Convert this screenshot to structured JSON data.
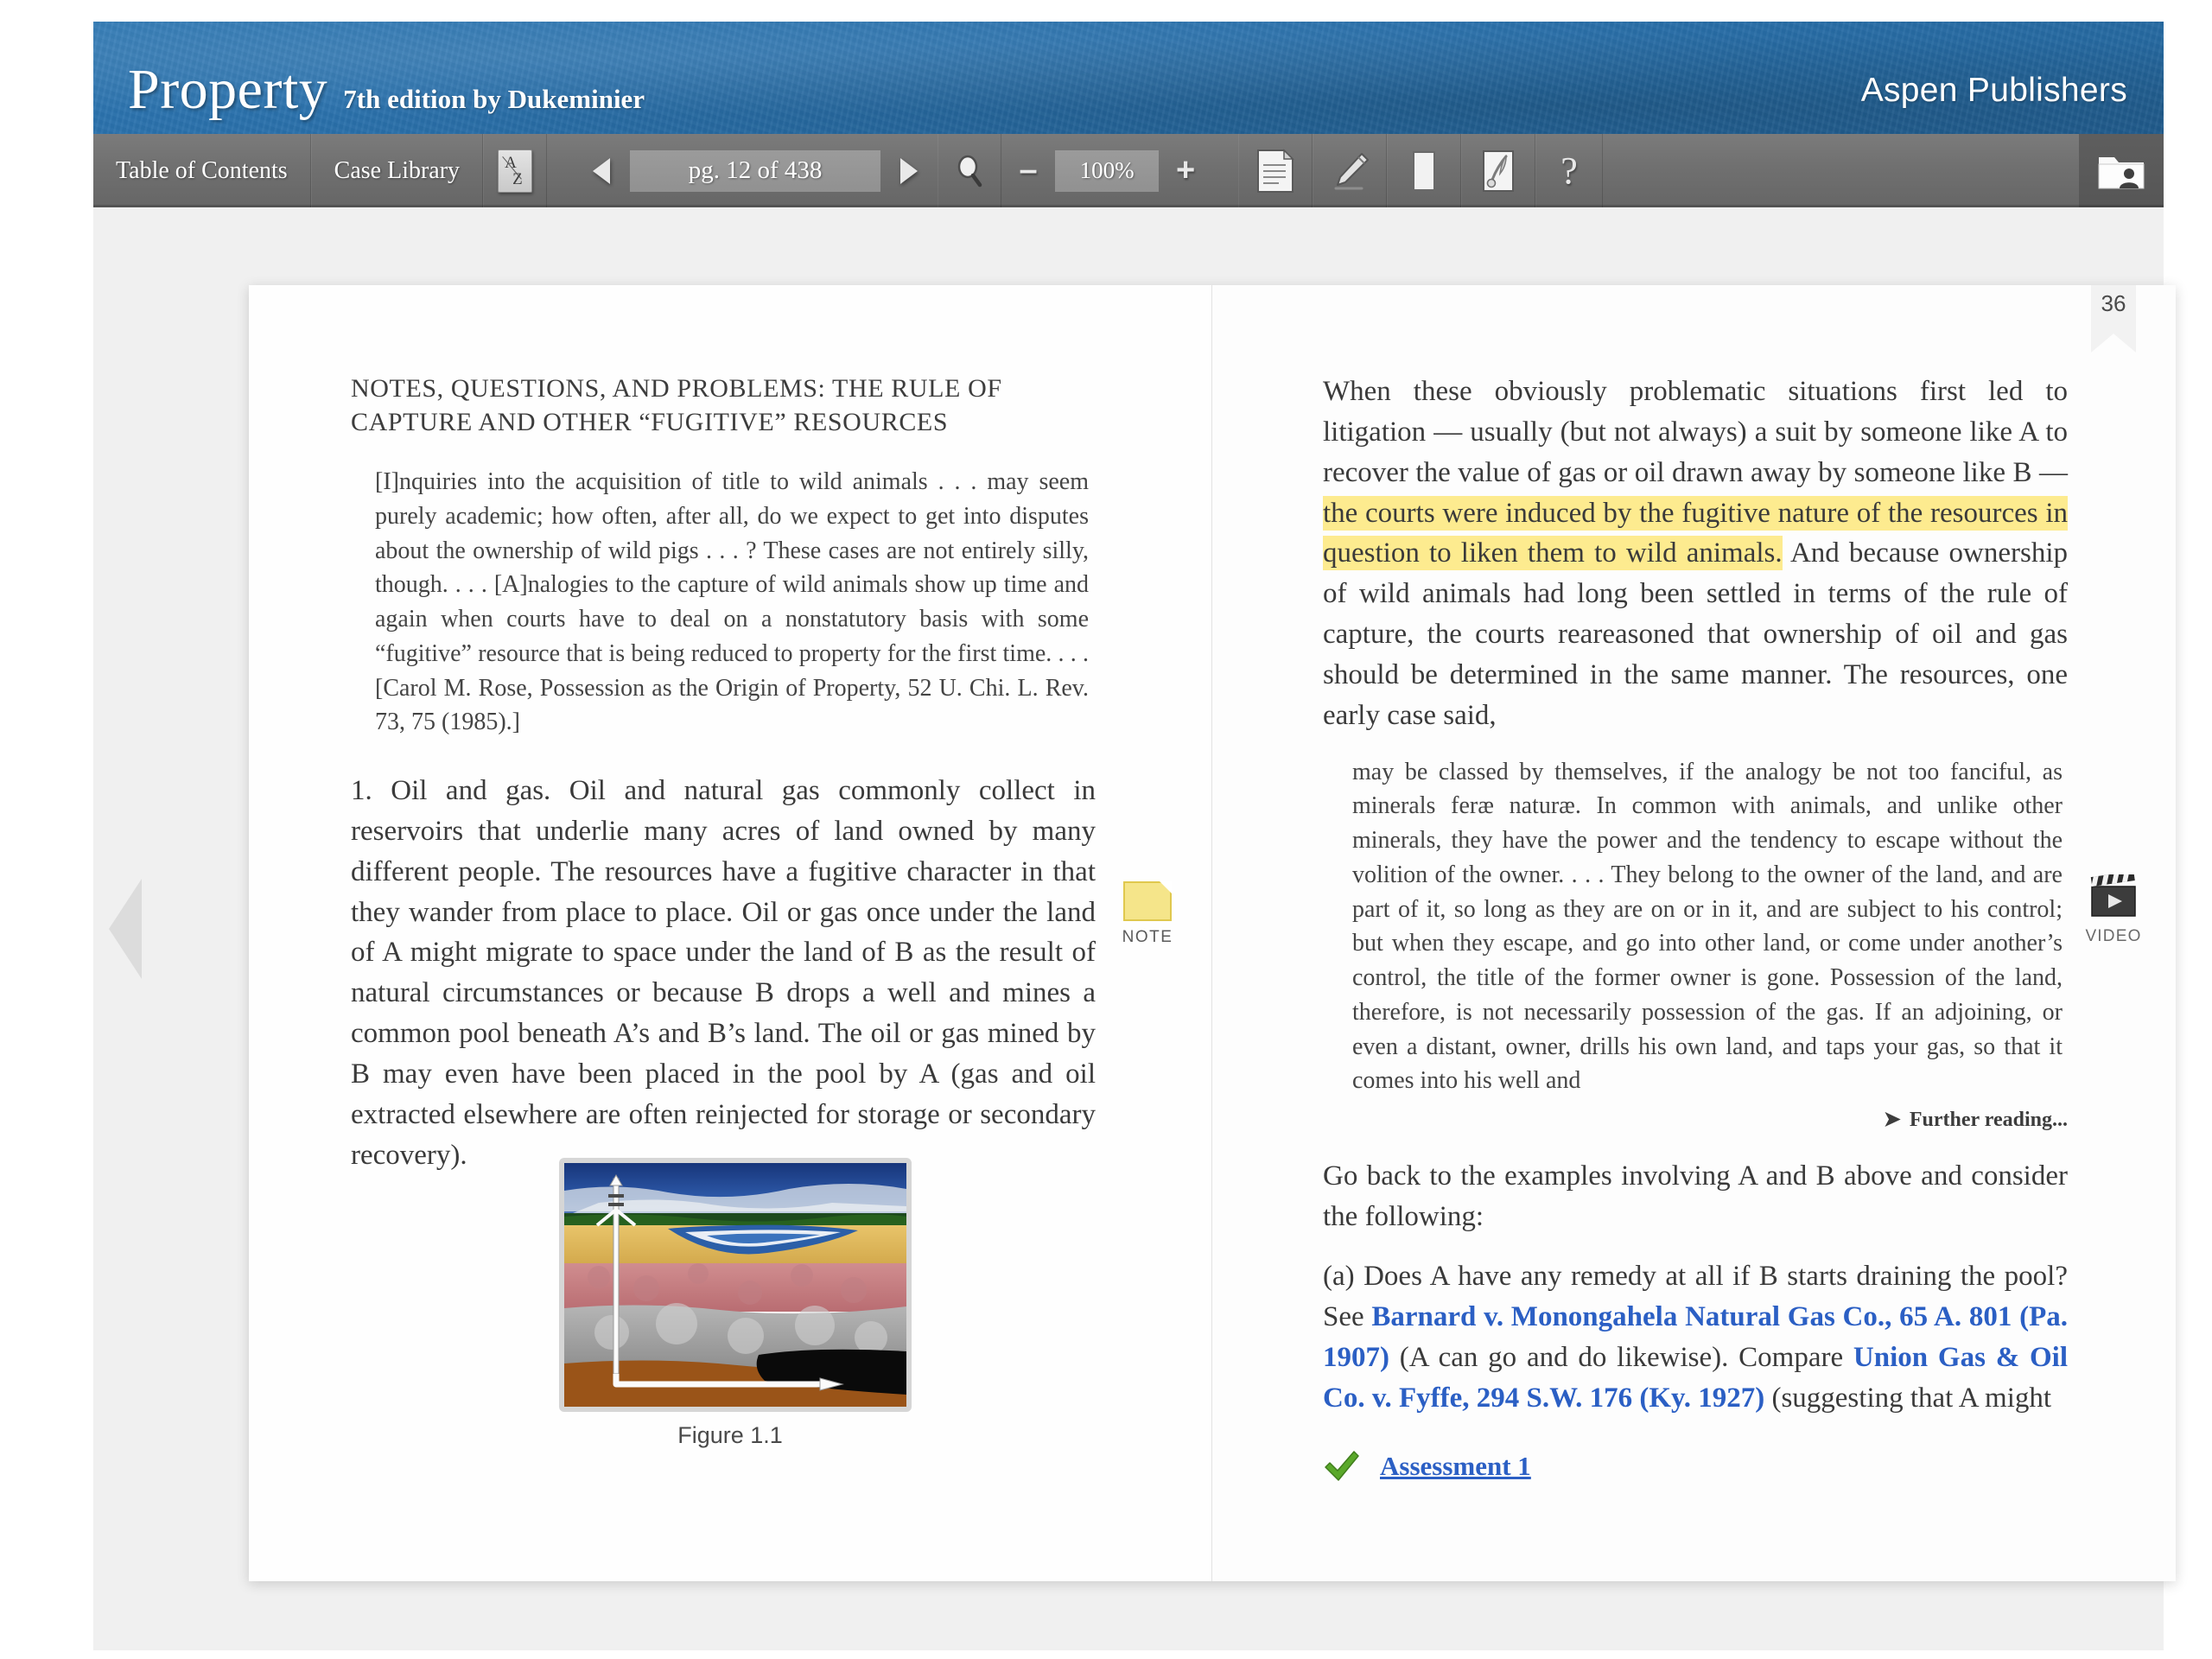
{
  "header": {
    "book_title": "Property",
    "book_subtitle": "7th edition by Dukeminier",
    "publisher": "Aspen Publishers",
    "brand_color": "#2b72ad"
  },
  "toolbar": {
    "table_of_contents": "Table of Contents",
    "case_library": "Case Library",
    "glossary_icon": "a-z-glossary-icon",
    "prev_page_icon": "arrow-left-icon",
    "page_value": "pg. 12 of 438",
    "next_page_icon": "arrow-right-icon",
    "search_icon": "search-icon",
    "zoom_out_label": "–",
    "zoom_value": "100%",
    "zoom_in_label": "+",
    "notes_icon": "notes-document-icon",
    "highlighter_icon": "highlighter-pen-icon",
    "bookmark_icon": "bookmark-icon",
    "annotations_icon": "quill-notebook-icon",
    "help_label": "?",
    "my_folder_icon": "user-folder-icon"
  },
  "reader": {
    "prev_page_chevron": "chevron-left-icon",
    "next_page_chevron": "chevron-right-icon",
    "bookmark_page_number": "36"
  },
  "left_page": {
    "section_heading": "NOTES, QUESTIONS, AND PROBLEMS: THE RULE OF CAPTURE AND OTHER “FUGITIVE” RESOURCES",
    "blockquote": "[I]nquiries into the acquisition of title to wild animals . . . may seem purely academic; how often, after all, do we expect to get into disputes about the ownership of wild pigs . . . ? These cases are not entirely silly, though. . . . [A]nalogies to the capture of wild animals show up time and again when courts have to deal on a nonstatutory basis with some “fugitive” resource that is being reduced to property for the first time. . . . [Carol M. Rose, Possession as the Origin of Property, 52 U. Chi. L. Rev. 73, 75 (1985).]",
    "body_paragraph": "1. Oil and gas. Oil and natural gas commonly collect in reservoirs that underlie many acres of land owned by many different people. The resources have a fugitive character in that they wander from place to place. Oil or gas once under the land of A might migrate to space under the land of B as the result of natural circumstances or because B drops a well and mines a common pool beneath A’s and B’s land. The oil or gas mined by B may even have been placed in the pool by A (gas and oil extracted elsewhere are often reinjected for storage or secondary recovery).",
    "note_marker_label": "NOTE",
    "figure_caption": "Figure 1.1"
  },
  "right_page": {
    "para_1_before_highlight": "When these obviously problematic situations first led to litigation — usually (but not always) a suit by someone like A to recover the value of gas or oil drawn away by someone like B — ",
    "para_1_highlight": "the courts were induced by the fugitive nature of the resources in question to liken them to wild animals.",
    "para_1_after_highlight": " And because ownership of wild animals had long been settled in terms of the rule of capture, the courts reareasoned that ownership of oil and gas should be determined in the same manner. The resources, one early case said,",
    "highlight_color": "#fdeb8f",
    "blockquote": "may be classed by themselves, if the analogy be not too fanciful, as minerals feræ naturæ. In common with animals, and unlike other minerals, they have the power and the tendency to escape without the volition of the owner. . . . They belong to the owner of the land, and are part of it, so long as they are on or in it, and are subject to his control; but when they escape, and go into other land, or come under another’s control, the title of the former owner is gone. Possession of the land, therefore, is not necessarily possession of the gas. If an adjoining, or even a distant, owner, drills his own land, and taps your gas, so that it comes into his well and",
    "further_reading": "Further reading...",
    "para_2": "Go back to the examples involving A and B above and consider the following:",
    "para_3_a": "(a) Does A have any remedy at all if B starts draining the pool? See ",
    "case_link_1": "Barnard v. Monongahela Natural Gas Co., 65 A. 801 (Pa. 1907)",
    "para_3_b": " (A can go and do likewise). Compare ",
    "case_link_2": "Union Gas & Oil Co. v. Fyffe, 294 S.W. 176 (Ky. 1927)",
    "para_3_c": " (suggesting that A might",
    "assessment_label": "Assessment 1",
    "assessment_icon": "green-check-icon",
    "video_marker_label": "VIDEO",
    "link_color": "#2b5fc4"
  }
}
